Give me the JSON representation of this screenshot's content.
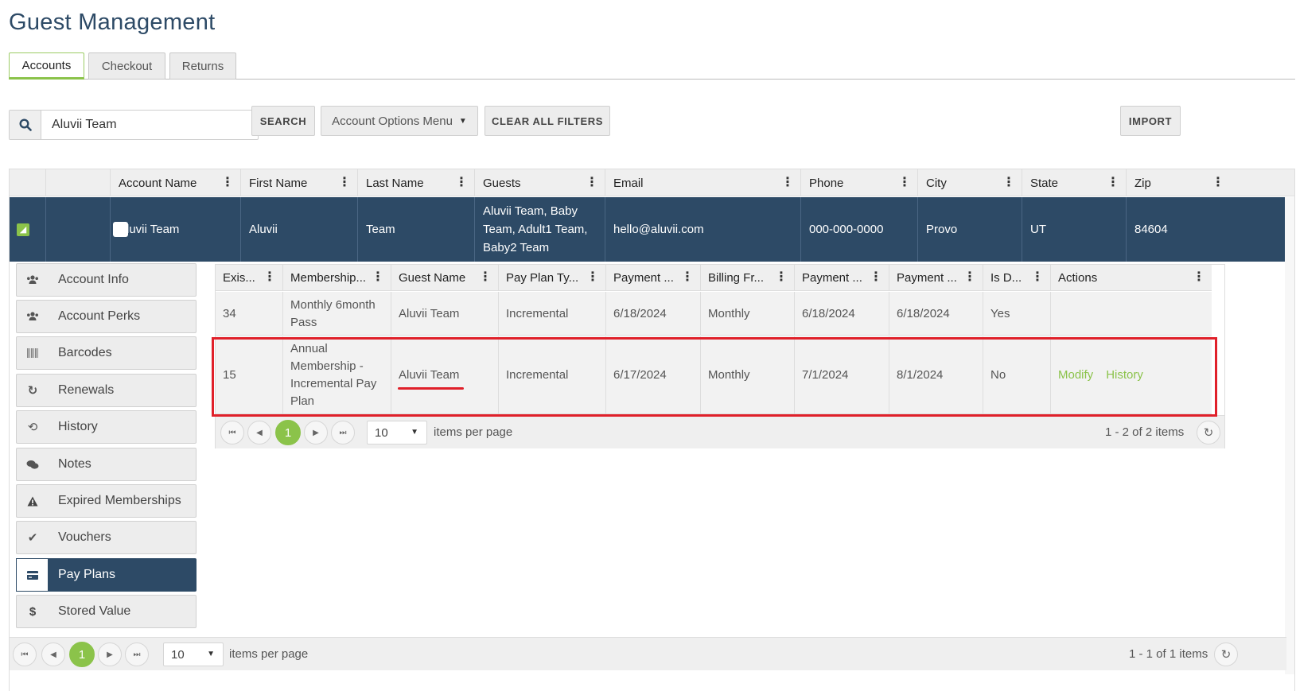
{
  "page": {
    "title": "Guest Management"
  },
  "tabs": [
    {
      "label": "Accounts",
      "active": true
    },
    {
      "label": "Checkout",
      "active": false
    },
    {
      "label": "Returns",
      "active": false
    }
  ],
  "toolbar": {
    "search_value": "Aluvii Team",
    "search_button": "SEARCH",
    "options_menu": "Account Options Menu",
    "clear_filters": "CLEAR ALL FILTERS",
    "import": "IMPORT"
  },
  "grid": {
    "columns": [
      "Account Name",
      "First Name",
      "Last Name",
      "Guests",
      "Email",
      "Phone",
      "City",
      "State",
      "Zip"
    ],
    "selected_row": {
      "account_name": "Aluvii Team",
      "first_name": "Aluvii",
      "last_name": "Team",
      "guests": "Aluvii Team, Baby Team, Adult1 Team, Baby2 Team",
      "email": "hello@aluvii.com",
      "phone": "000-000-0000",
      "city": "Provo",
      "state": "UT",
      "zip": "84604"
    },
    "pager": {
      "current_page": "1",
      "page_size": "10",
      "items_per_page_label": "items per page",
      "summary": "1 - 1 of 1 items"
    }
  },
  "sidebar": {
    "items": [
      {
        "label": "Account Info",
        "icon": "users-icon"
      },
      {
        "label": "Account Perks",
        "icon": "users-icon"
      },
      {
        "label": "Barcodes",
        "icon": "barcode-icon"
      },
      {
        "label": "Renewals",
        "icon": "refresh-icon"
      },
      {
        "label": "History",
        "icon": "history-icon"
      },
      {
        "label": "Notes",
        "icon": "comments-icon"
      },
      {
        "label": "Expired Memberships",
        "icon": "warning-icon"
      },
      {
        "label": "Vouchers",
        "icon": "check-icon"
      },
      {
        "label": "Pay Plans",
        "icon": "credit-card-icon",
        "active": true
      },
      {
        "label": "Stored Value",
        "icon": "dollar-icon"
      }
    ]
  },
  "payplans": {
    "columns": [
      "Exis...",
      "Membership...",
      "Guest Name",
      "Pay Plan Ty...",
      "Payment ...",
      "Billing Fr...",
      "Payment ...",
      "Payment ...",
      "Is D...",
      "Actions"
    ],
    "rows": [
      {
        "id": "34",
        "membership": "Monthly 6month Pass",
        "guest": "Aluvii Team",
        "plan_type": "Incremental",
        "payment1": "6/18/2024",
        "billing": "Monthly",
        "payment2": "6/18/2024",
        "payment3": "6/18/2024",
        "is_d": "Yes"
      },
      {
        "id": "15",
        "membership": "Annual Membership - Incremental Pay Plan",
        "guest": "Aluvii Team",
        "plan_type": "Incremental",
        "payment1": "6/17/2024",
        "billing": "Monthly",
        "payment2": "7/1/2024",
        "payment3": "8/1/2024",
        "is_d": "No",
        "actions": [
          "Modify",
          "History"
        ]
      }
    ],
    "pager": {
      "current_page": "1",
      "page_size": "10",
      "items_per_page_label": "items per page",
      "summary": "1 - 2 of 2 items"
    }
  },
  "colors": {
    "navy": "#2d4a66",
    "accent_green": "#8bc34a",
    "highlight_red": "#e0202a"
  }
}
